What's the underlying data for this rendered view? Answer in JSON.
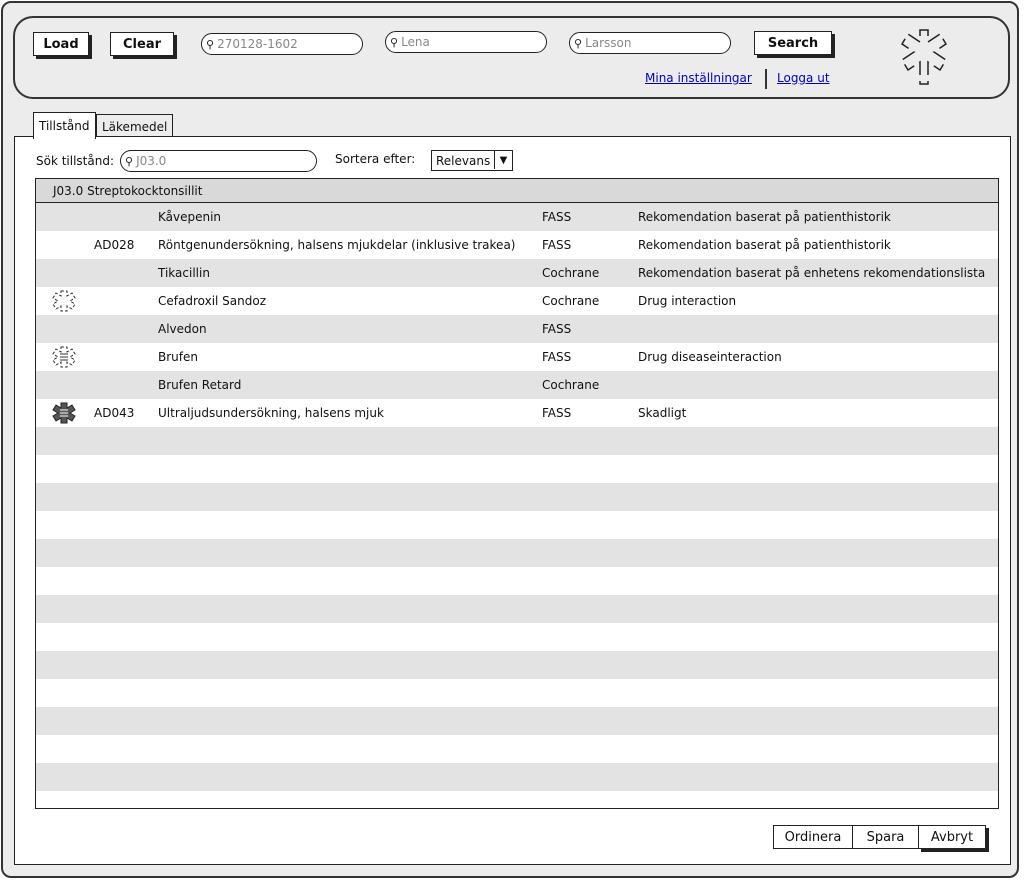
{
  "toolbar": {
    "load_label": "Load",
    "clear_label": "Clear",
    "search_label": "Search",
    "personnummer": "270128-1602",
    "first_name": "Lena",
    "last_name": "Larsson",
    "settings_link": "Mina inställningar",
    "logout_link": "Logga ut",
    "logo_icon": "star-of-life-icon"
  },
  "tabs": [
    {
      "label": "Tillstånd",
      "active": true
    },
    {
      "label": "Läkemedel",
      "active": false
    }
  ],
  "filter": {
    "search_label": "Sök tillstånd:",
    "search_value": "J03.0",
    "sort_label": "Sortera efter:",
    "sort_value": "Relevans"
  },
  "table": {
    "group_title": "J03.0 Streptokocktonsillit",
    "rows": [
      {
        "icon": "",
        "code": "",
        "name": "Kåvepenin",
        "source": "FASS",
        "recommendation": "Rekomendation baserat på patienthistorik"
      },
      {
        "icon": "",
        "code": "AD028",
        "name": "Röntgenundersökning, halsens mjukdelar (inklusive trakea)",
        "source": "FASS",
        "recommendation": "Rekomendation baserat på patienthistorik"
      },
      {
        "icon": "",
        "code": "",
        "name": "Tikacillin",
        "source": "Cochrane",
        "recommendation": "Rekomendation baserat på enhetens rekomendationslista"
      },
      {
        "icon": "warning-outline-icon",
        "code": "",
        "name": "Cefadroxil Sandoz",
        "source": "Cochrane",
        "recommendation": "Drug interaction"
      },
      {
        "icon": "",
        "code": "",
        "name": "Alvedon",
        "source": "FASS",
        "recommendation": ""
      },
      {
        "icon": "warning-lines-icon",
        "code": "",
        "name": "Brufen",
        "source": "FASS",
        "recommendation": "Drug diseaseinteraction"
      },
      {
        "icon": "",
        "code": "",
        "name": "Brufen Retard",
        "source": "Cochrane",
        "recommendation": ""
      },
      {
        "icon": "warning-filled-icon",
        "code": "AD043",
        "name": "Ultraljudsundersökning, halsens mjuk",
        "source": "FASS",
        "recommendation": "Skadligt"
      }
    ],
    "empty_rows": 13
  },
  "footer": {
    "order_label": "Ordinera",
    "save_label": "Spara",
    "cancel_label": "Avbryt"
  }
}
